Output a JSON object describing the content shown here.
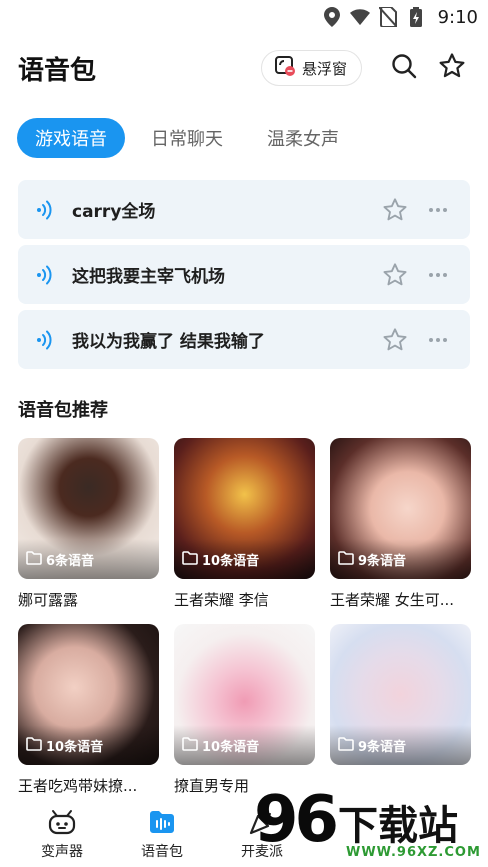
{
  "status_bar": {
    "time": "9:10"
  },
  "header": {
    "title": "语音包",
    "float_window_label": "悬浮窗"
  },
  "tabs": [
    {
      "label": "游戏语音",
      "active": true
    },
    {
      "label": "日常聊天",
      "active": false
    },
    {
      "label": "温柔女声",
      "active": false
    }
  ],
  "clips": [
    {
      "label": "carry全场"
    },
    {
      "label": "这把我要主宰飞机场"
    },
    {
      "label": "我以为我赢了 结果我输了"
    }
  ],
  "recommend": {
    "title": "语音包推荐",
    "packs": [
      {
        "count": "6条语音",
        "title": "娜可露露"
      },
      {
        "count": "10条语音",
        "title": "王者荣耀 李信"
      },
      {
        "count": "9条语音",
        "title": "王者荣耀 女生可..."
      },
      {
        "count": "10条语音",
        "title": "王者吃鸡带妹撩..."
      },
      {
        "count": "10条语音",
        "title": "撩直男专用"
      },
      {
        "count": "9条语音",
        "title": ""
      }
    ]
  },
  "bottom_nav": [
    {
      "label": "变声器",
      "icon": "robot-face-icon"
    },
    {
      "label": "语音包",
      "icon": "voice-pack-icon"
    },
    {
      "label": "开麦派",
      "icon": "party-popper-icon"
    }
  ],
  "watermark": {
    "number": "96",
    "text": "下载站",
    "url": "WWW.96XZ.COM"
  },
  "colors": {
    "accent": "#1a95f0",
    "clip_bg": "#eef4f9",
    "watermark_green": "#2d9a33"
  }
}
